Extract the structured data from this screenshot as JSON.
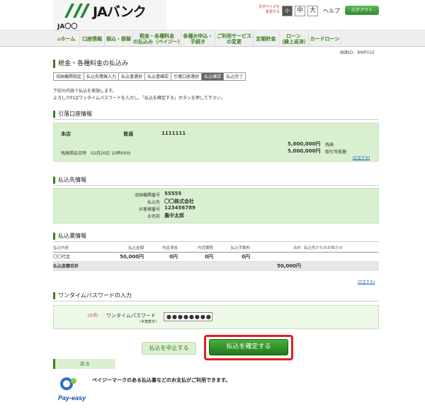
{
  "header": {
    "logo_text": "JAバンク",
    "logo_sub": "JA〇〇",
    "fontsize_label_1": "文字サイズを",
    "fontsize_label_2": "変更する",
    "fs_small": "小",
    "fs_mid": "中",
    "fs_big": "大",
    "help": "ヘルプ",
    "logout": "ログアウト"
  },
  "nav": {
    "items": [
      {
        "label": "ホーム"
      },
      {
        "label": "口座情報"
      },
      {
        "label": "振込・振替"
      },
      {
        "label_1": "税金・各種料金",
        "label_2": "の払込み（ペイジー）"
      },
      {
        "label_1": "各種お申込・",
        "label_2": "手続き"
      },
      {
        "label_1": "ご利用サービス",
        "label_2": "の変更"
      },
      {
        "label": "定期貯金"
      },
      {
        "label_1": "ローン",
        "label_2": "（繰上返済）"
      },
      {
        "label": "カードローン"
      }
    ]
  },
  "screen_id": "画面ID：BMP010",
  "page_title": "税金・各種料金の払込み",
  "steps": [
    "収納機関指定",
    "払込先情報入力",
    "払込書選択",
    "払込書確認",
    "引落口座選択",
    "払込確認",
    "払込完了"
  ],
  "intro": {
    "line1": "下記の内容で払込を実施します。",
    "line2": "よろしければワンタイムパスワードを入力し、「払込を確定する」ボタンを押して下さい。"
  },
  "account": {
    "section_title": "引落口座情報",
    "branch": "本店",
    "type": "普通",
    "number": "1111111",
    "balance_amount": "5,000,000円",
    "balance_label": "残高",
    "available_amount": "5,000,000円",
    "available_label": "取引可能額",
    "inquiry": "残高照会日時　02月20日 10時00分",
    "edit": "[訂正する]"
  },
  "payee": {
    "section_title": "払込先情報",
    "rows": [
      {
        "label": "収納機関番号",
        "value": "55555"
      },
      {
        "label": "払込先",
        "value": "〇〇株式会社"
      },
      {
        "label": "お客様番号",
        "value": "123456789"
      },
      {
        "label": "お名前",
        "value": "農中太郎"
      }
    ]
  },
  "bill": {
    "section_title": "払込書情報",
    "headers": [
      "払込内容",
      "払込金額",
      "内延滞金",
      "内消費税",
      "払込手数料",
      "合計",
      "払込先からのお知らせ"
    ],
    "row": [
      "〇〇代金",
      "50,000円",
      "0円",
      "0円",
      "0円",
      "",
      ""
    ],
    "total_label": "払込金額合計",
    "total_value": "50,000円",
    "edit": "[訂正する]"
  },
  "otp": {
    "section_title": "ワンタイムパスワードの入力",
    "required": "[必須]",
    "label": "ワンタイムパスワード",
    "hint": "（半角数字）",
    "value": "●●●●●●●●"
  },
  "buttons": {
    "cancel": "払込を中止する",
    "confirm": "払込を確定する",
    "back": "戻る"
  },
  "payeasy": {
    "logo": "Pay-easy",
    "text": "ペイジーマークのある払込書などのお支払がご利用できます。"
  }
}
